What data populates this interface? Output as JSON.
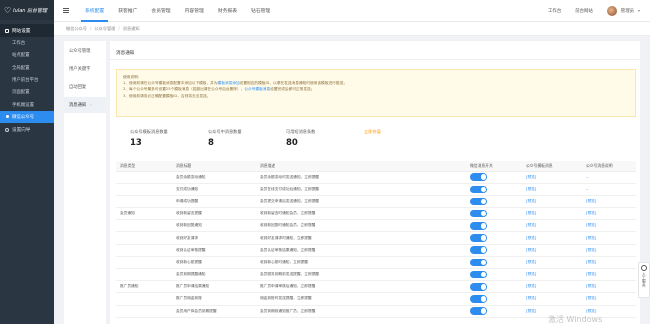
{
  "app": {
    "logo_text": "Iulan 后台管理"
  },
  "sidebar": {
    "group_title": "网站设置",
    "items": [
      {
        "label": "工作台"
      },
      {
        "label": "站点配置"
      },
      {
        "label": "全局配置"
      },
      {
        "label": "用户前台平台"
      },
      {
        "label": "页面配置"
      },
      {
        "label": "手机端设置"
      },
      {
        "label": "微信公众号"
      }
    ],
    "second_group": "设置向导"
  },
  "topnav": {
    "items": [
      "系统配置",
      "获客推广",
      "会员管理",
      "内容管理",
      "财务报表",
      "钻石管理"
    ],
    "active_index": 0,
    "right": {
      "workbench": "工作台",
      "front_site": "前台网站",
      "username": "管理员"
    }
  },
  "breadcrumb": [
    "微信公众号",
    "公众号管理",
    "消息通知"
  ],
  "subside": {
    "items": [
      {
        "label": "公众号管理"
      },
      {
        "label": "用户关键字"
      },
      {
        "label": "自动回复"
      },
      {
        "label": "消息通知"
      }
    ],
    "active_index": 3
  },
  "main": {
    "title": "消息通知",
    "notice": {
      "heading": "使用说明：",
      "line1_a": "1、使用前请在公众号模板消息配置中添加以下模板，并为",
      "line1_link": "模板消息添加",
      "line1_b": "设置相应的模板ID，以便在发送消息通知时使用该模板进行推送；",
      "line2_a": "2、每个公众号最多可设置25个模板消息（若超出请在公众号后台删除），",
      "line2_link": "公众号模板消息",
      "line2_b": "设置完成后即可正常发送；",
      "line3": "3、使用前请务必正确配置模板ID，否则将无法发送。"
    },
    "stats": [
      {
        "label": "公众号模板消息数量",
        "value": "13"
      },
      {
        "label": "公众号中消息数量",
        "value": "8"
      },
      {
        "label": "可用短消息条数",
        "value": "80"
      }
    ],
    "stats_link": "立即充值",
    "table": {
      "headers": [
        "消息类型",
        "消息标题",
        "消息描述",
        "微信消息开关",
        "公众号模板消息",
        "公众号消息说明"
      ],
      "rows": [
        {
          "group": "",
          "title": "会员余额变动通知",
          "desc": "会员余额变动时发送通知，立即提醒",
          "tpl": "[预览]",
          "note": "--"
        },
        {
          "group": "",
          "title": "支付成功通知",
          "desc": "会员在线支付成功后通知，立即提醒",
          "tpl": "[预览]",
          "note": "--"
        },
        {
          "group": "",
          "title": "申请成功提醒",
          "desc": "会员提交申请后发送通知，立即提醒",
          "tpl": "[预览]",
          "note": "[预览]"
        },
        {
          "group": "会员通知",
          "title": "收到新留言提醒",
          "desc": "收到新留言时通知会员，立即提醒",
          "tpl": "[预览]",
          "note": "[预览]"
        },
        {
          "group": "",
          "title": "收到新回复通知",
          "desc": "收到新回复时通知会员，立即提醒",
          "tpl": "[预览]",
          "note": "[预览]"
        },
        {
          "group": "",
          "title": "收到好友请求",
          "desc": "收到好友请求时通知，立即提醒",
          "tpl": "[预览]",
          "note": "[预览]"
        },
        {
          "group": "",
          "title": "收到认证审核提醒",
          "desc": "会员认证审核结果通知，立即提醒",
          "tpl": "[预览]",
          "note": "[预览]"
        },
        {
          "group": "",
          "title": "收到新心愿提醒",
          "desc": "收到新心愿时通知，立即提醒",
          "tpl": "[预览]",
          "note": "[预览]"
        },
        {
          "group": "",
          "title": "会员到期提醒通知",
          "desc": "会员服务到期前发送提醒，立即提醒",
          "tpl": "[预览]",
          "note": "[预览]"
        },
        {
          "group": "推广员通知",
          "title": "推广员申请结果通知",
          "desc": "推广员申请审核后通知，立即提醒",
          "tpl": "[预览]",
          "note": "[预览]"
        },
        {
          "group": "",
          "title": "推广员佣金到账",
          "desc": "佣金到账时发送提醒，立即提醒",
          "tpl": "[预览]",
          "note": "[预览]"
        },
        {
          "group": "",
          "title": "会员用户体会员到期提醒",
          "desc": "会员到期前通知推广员，立即提醒",
          "tpl": "[预览]",
          "note": "[预览]"
        }
      ]
    }
  },
  "help": {
    "label": "人工服务"
  },
  "watermark": "激活 Windows"
}
